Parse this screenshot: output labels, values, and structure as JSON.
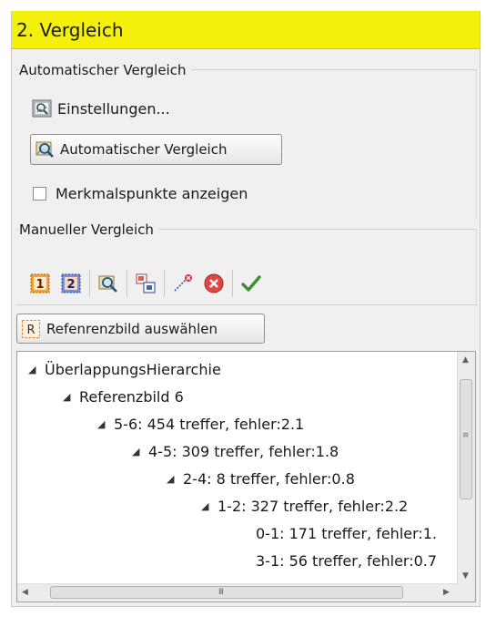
{
  "section": {
    "title": "2. Vergleich",
    "accent": "#f4f00c"
  },
  "auto": {
    "group_label": "Automatischer Vergleich",
    "settings_label": "Einstellungen...",
    "compare_button": "Automatischer Vergleich",
    "show_features_label": "Merkmalspunkte anzeigen",
    "show_features_checked": false
  },
  "manual": {
    "group_label": "Manueller Vergleich",
    "toolbar": [
      {
        "icon": "image-1-icon",
        "text": "1"
      },
      {
        "icon": "image-2-icon",
        "text": "2"
      },
      {
        "icon": "magnifier-compare-icon"
      },
      {
        "icon": "region-select-icon"
      },
      {
        "icon": "delete-point-icon"
      },
      {
        "icon": "cancel-icon"
      },
      {
        "icon": "checkmark-icon"
      }
    ],
    "reference_button": "Refenrenzbild auswählen",
    "reference_icon_letter": "R"
  },
  "tree": {
    "nodes": [
      {
        "label": "ÜberlappungsHierarchie",
        "expanded": true
      },
      {
        "label": "Referenzbild 6",
        "expanded": true
      },
      {
        "label": "5-6: 454 treffer, fehler:2.1",
        "expanded": true
      },
      {
        "label": "4-5: 309 treffer, fehler:1.8",
        "expanded": true
      },
      {
        "label": "2-4: 8 treffer, fehler:0.8",
        "expanded": true
      },
      {
        "label": "1-2: 327 treffer, fehler:2.2",
        "expanded": true
      },
      {
        "label": "0-1: 171 treffer, fehler:1.",
        "expanded": false
      },
      {
        "label": "3-1: 56 treffer, fehler:0.7",
        "expanded": false
      }
    ],
    "hscroll_grip": "III",
    "vscroll_grip": "≡"
  }
}
